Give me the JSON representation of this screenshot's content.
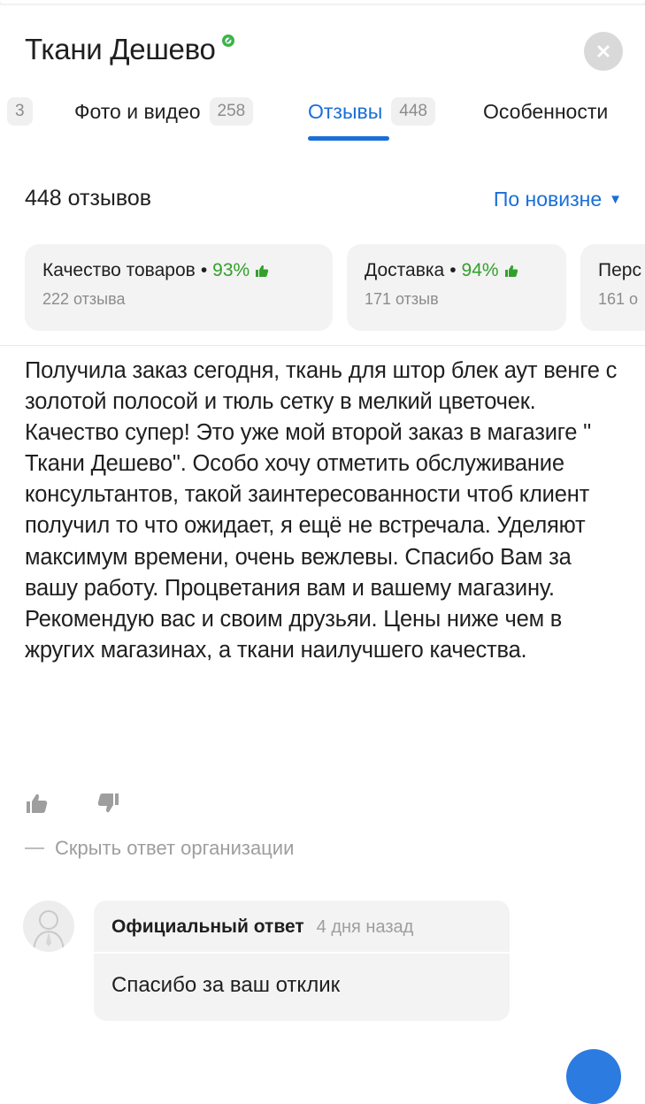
{
  "header": {
    "title": "Ткани Дешево"
  },
  "tabs": [
    {
      "label": "3"
    },
    {
      "label": "Фото и видео",
      "count": "258"
    },
    {
      "label": "Отзывы",
      "count": "448"
    },
    {
      "label": "Особенности"
    }
  ],
  "reviews": {
    "count_label": "448 отзывов",
    "sort_label": "По новизне"
  },
  "aspects": [
    {
      "name": "Качество товаров",
      "percent": "93%",
      "sub": "222 отзыва"
    },
    {
      "name": "Доставка",
      "percent": "94%",
      "sub": "171 отзыв"
    },
    {
      "name": "Перс",
      "sub": "161 о"
    }
  ],
  "review": {
    "text": "Получила заказ сегодня, ткань для штор блек аут венге с золотой полосой и тюль сетку в мелкий цветочек. Качество супер! Это уже мой второй заказ в магазиге \" Ткани Дешево\". Особо хочу отметить обслуживание консультантов, такой заинтересованности чтоб клиент получил то что ожидает, я ещё не встречала. Уделяют максимум времени, очень вежлевы. Спасибо Вам за вашу работу. Процветания вам и вашему магазину. Рекомендую вас и своим друзьяи. Цены ниже чем в жругих магазинах, а ткани наилучшего качества.",
    "hide_answer_label": "Скрыть ответ организации"
  },
  "answer": {
    "title": "Официальный ответ",
    "time": "4 дня назад",
    "text": "Спасибо за ваш отклик"
  },
  "colors": {
    "accent": "#1a6ed8",
    "positive": "#33a02c",
    "muted": "#9e9e9e",
    "card_bg": "#f3f3f3"
  }
}
